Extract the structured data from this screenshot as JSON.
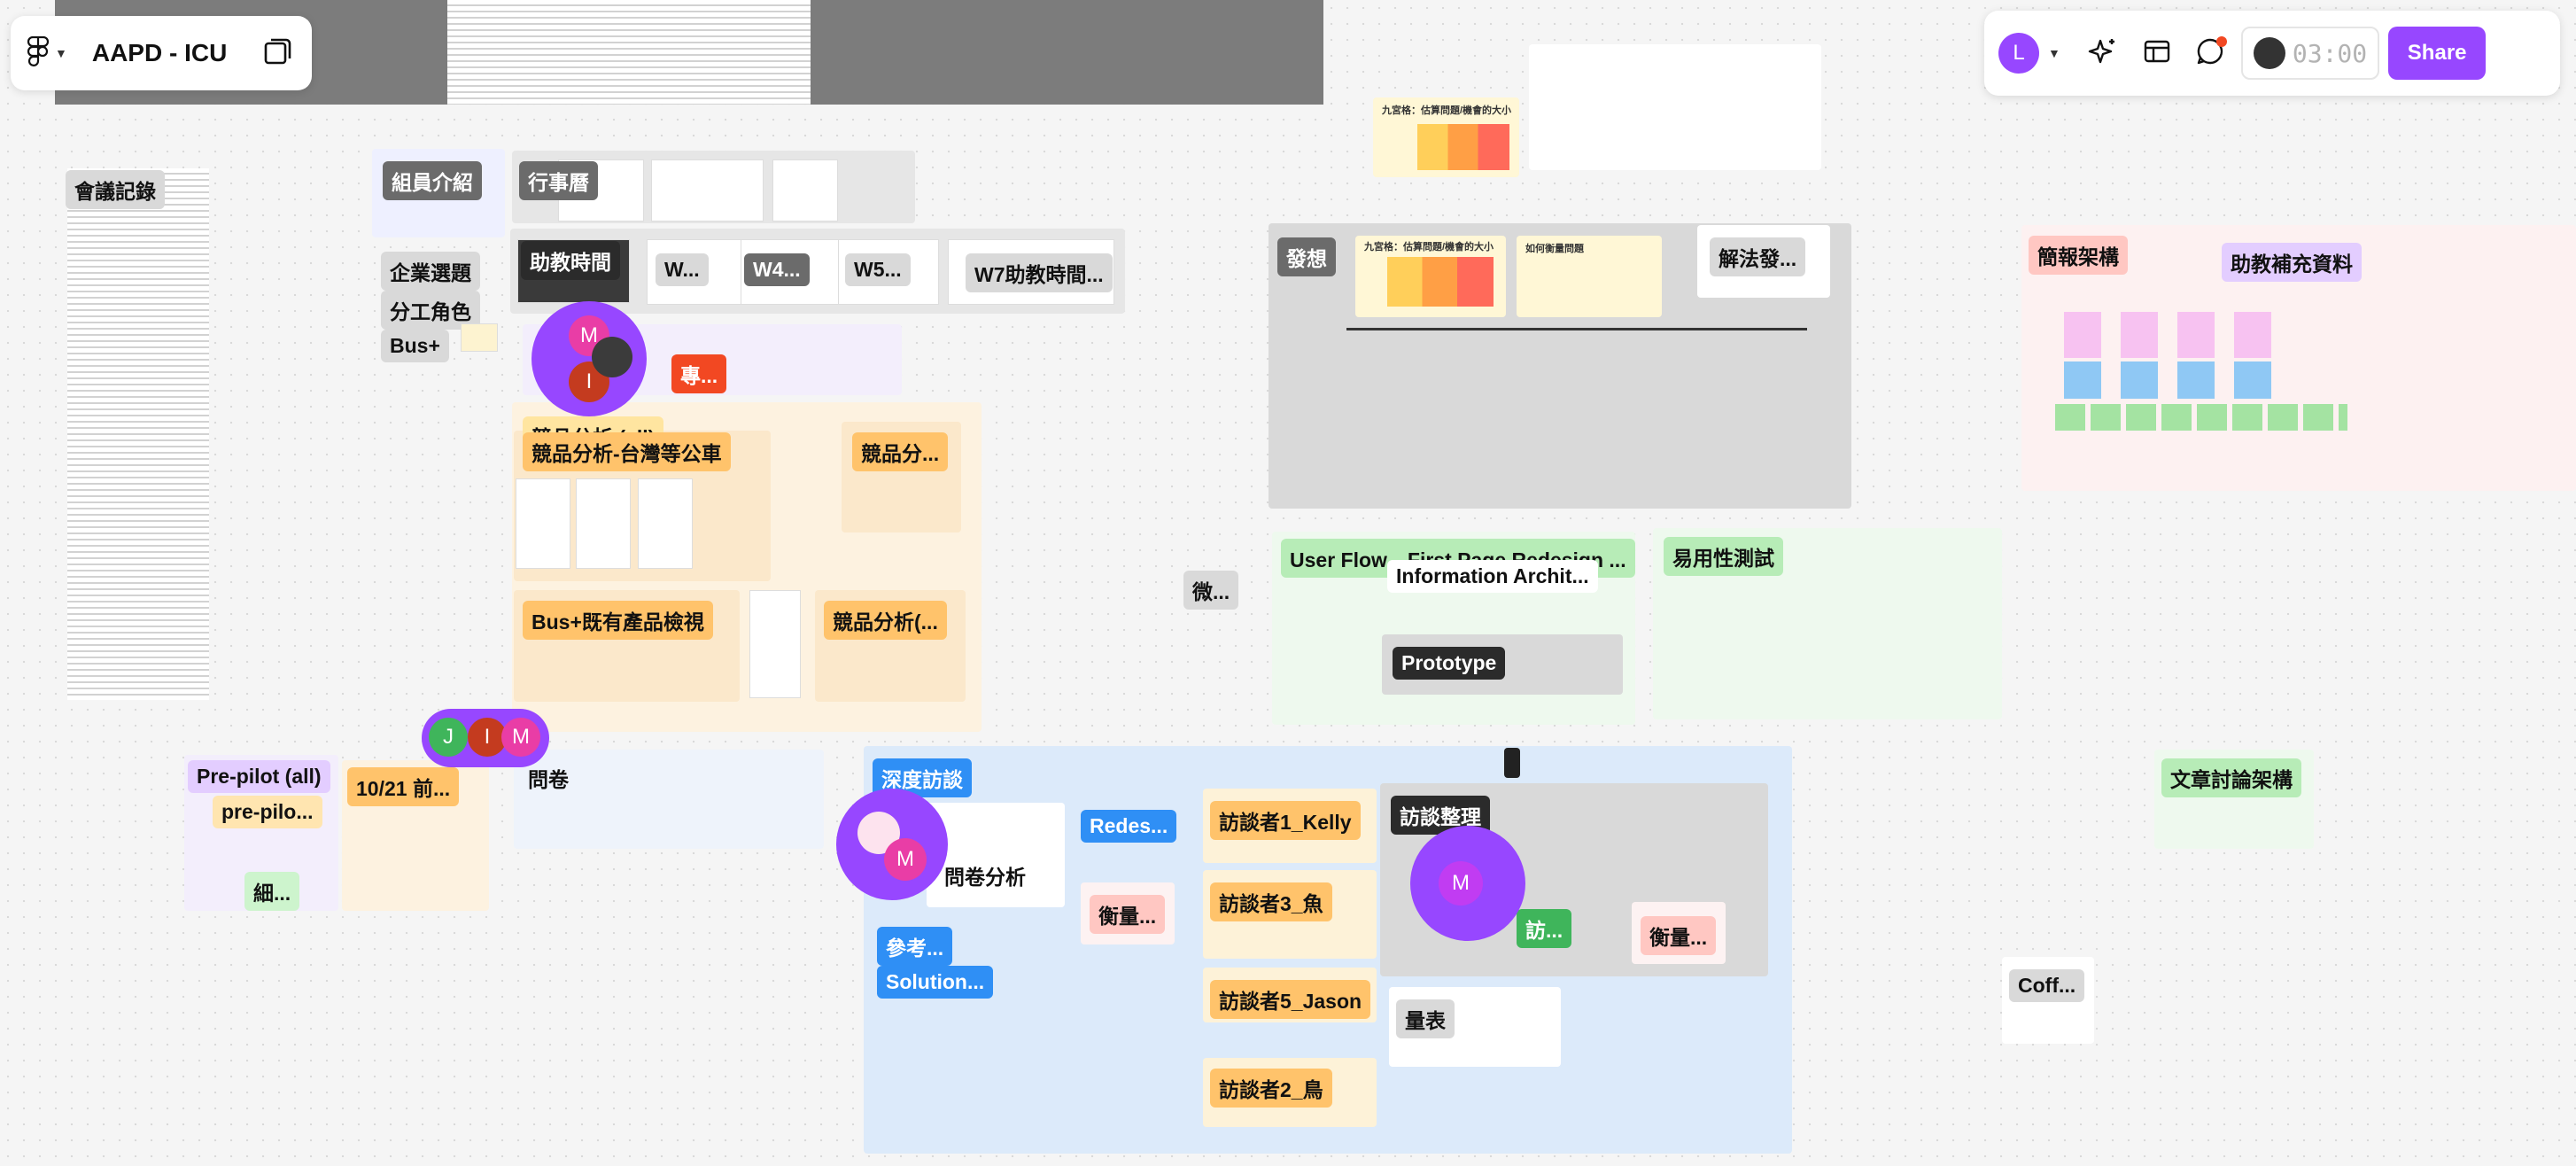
{
  "file": {
    "title": "AAPD - ICU"
  },
  "toolbar": {
    "user_initial": "L",
    "timer": "03:00",
    "share_label": "Share",
    "colors": {
      "accent": "#9747ff"
    }
  },
  "canvas": {
    "sections": {
      "meeting_notes": "會議記錄",
      "members": "組員介紹",
      "calendar": "行事曆",
      "company_topic": "企業選題",
      "roles": "分工角色",
      "busplus": "Bus+",
      "ta_time": "助教時間",
      "w1": "W...",
      "w4": "W4...",
      "w5": "W5...",
      "w7": "W7助教時間...",
      "special": "專...",
      "competitor_all": "競品分析 (all)",
      "competitor_tw": "競品分析-台灣等公車",
      "competitor_2": "競品分...",
      "busplus_review": "Bus+既有產品檢視",
      "competitor_3": "競品分析(...",
      "ideation": "發想",
      "solution": "解法發...",
      "userflow": "User Flow、First Page Redesign ...",
      "info_arch": "Information Archit...",
      "prototype": "Prototype",
      "usability": "易用性測試",
      "micro": "微...",
      "briefing": "簡報架構",
      "ta_supplement": "助教補充資料",
      "prepilot_all": "Pre-pilot (all)",
      "prepilot": "pre-pilo...",
      "detail": "細...",
      "oct21": "10/21 前...",
      "survey": "問卷",
      "depth_interview": "深度訪談",
      "survey_analysis": "問卷分析",
      "redesign": "Redes...",
      "measure1": "衡量...",
      "reference": "參考...",
      "solution2": "Solution...",
      "interviewee1": "訪談者1_Kelly",
      "interviewee3": "訪談者3_魚",
      "interviewee5": "訪談者5_Jason",
      "interviewee2": "訪談者2_鳥",
      "interview_summary": "訪談整理",
      "interview_short": "訪...",
      "measure2": "衡量...",
      "scale": "量表",
      "article_discussion": "文章討論架構",
      "coffee": "Coff..."
    },
    "frame_text": {
      "nine_grid": "九宮格：估算問題/機會的大小",
      "how_might_we": "如何衡量問題"
    },
    "cursors": {
      "c1": [
        "M",
        "I"
      ],
      "c2": [
        "J",
        "I",
        "M"
      ],
      "c3": [
        "M"
      ],
      "c4": [
        "M"
      ]
    }
  }
}
